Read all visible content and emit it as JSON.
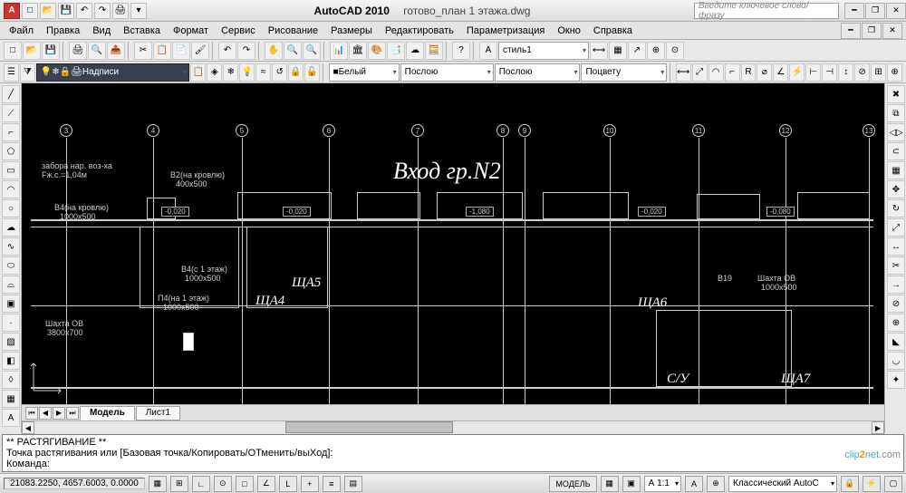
{
  "title": {
    "app": "AutoCAD 2010",
    "doc": "готово_план 1 этажа.dwg"
  },
  "search_placeholder": "Введите ключевое слово/фразу",
  "menu": [
    "Файл",
    "Правка",
    "Вид",
    "Вставка",
    "Формат",
    "Сервис",
    "Рисование",
    "Размеры",
    "Редактировать",
    "Параметризация",
    "Окно",
    "Справка"
  ],
  "layer_combo": "Надписи",
  "color_combo": "Белый",
  "ltype_combo": "Послою",
  "lweight_combo": "Послою",
  "plot_combo": "Поцвету",
  "style_combo": "стиль1",
  "drawing": {
    "main_title": "Вход гр.N2",
    "grid_marks": [
      "3",
      "4",
      "5",
      "6",
      "7",
      "8",
      "9",
      "10",
      "11",
      "12",
      "13"
    ],
    "labels": {
      "zabor": "забора нар. воз-ха",
      "fzhs": "Fж.с.=1,04м",
      "b2": "B2(на кровлю)",
      "b2s": "400x500",
      "b4": "B4(на кровлю)",
      "b4s": "1000x500",
      "b4_1": "B4(с 1 этаж)",
      "b4_1s": "1000x500",
      "p4": "П4(на 1 этаж)",
      "p4s": "1000x500",
      "shaft_ob": "Шахта ОВ",
      "shaft_obs": "3800x700",
      "b19": "B19",
      "shaft_ob2": "Шахта ОВ",
      "shaft_ob2s": "1000x500",
      "shcha4": "ЩА4",
      "shcha5": "ЩА5",
      "shcha6": "ЩА6",
      "shcha7": "ЩА7",
      "su": "С/У"
    },
    "elev_tags": [
      "-0,020",
      "-0,020",
      "-1,080",
      "-0,020",
      "-0,080"
    ]
  },
  "tabs": {
    "model": "Модель",
    "layout1": "Лист1"
  },
  "command": {
    "l1": "** РАСТЯГИВАНИЕ **",
    "l2": "Точка растягивания или [Базовая точка/Копировать/ОТменить/выХод]:",
    "prompt": "Команда:"
  },
  "status": {
    "coords": "21083.2250, 4657.6003, 0.0000",
    "model_btn": "МОДЕЛЬ",
    "scale": "А 1:1",
    "ann": "А",
    "workspace": "Классический AutoC"
  },
  "watermark_a": "clip",
  "watermark_b": "2",
  "watermark_c": "net",
  "watermark_d": ".com"
}
